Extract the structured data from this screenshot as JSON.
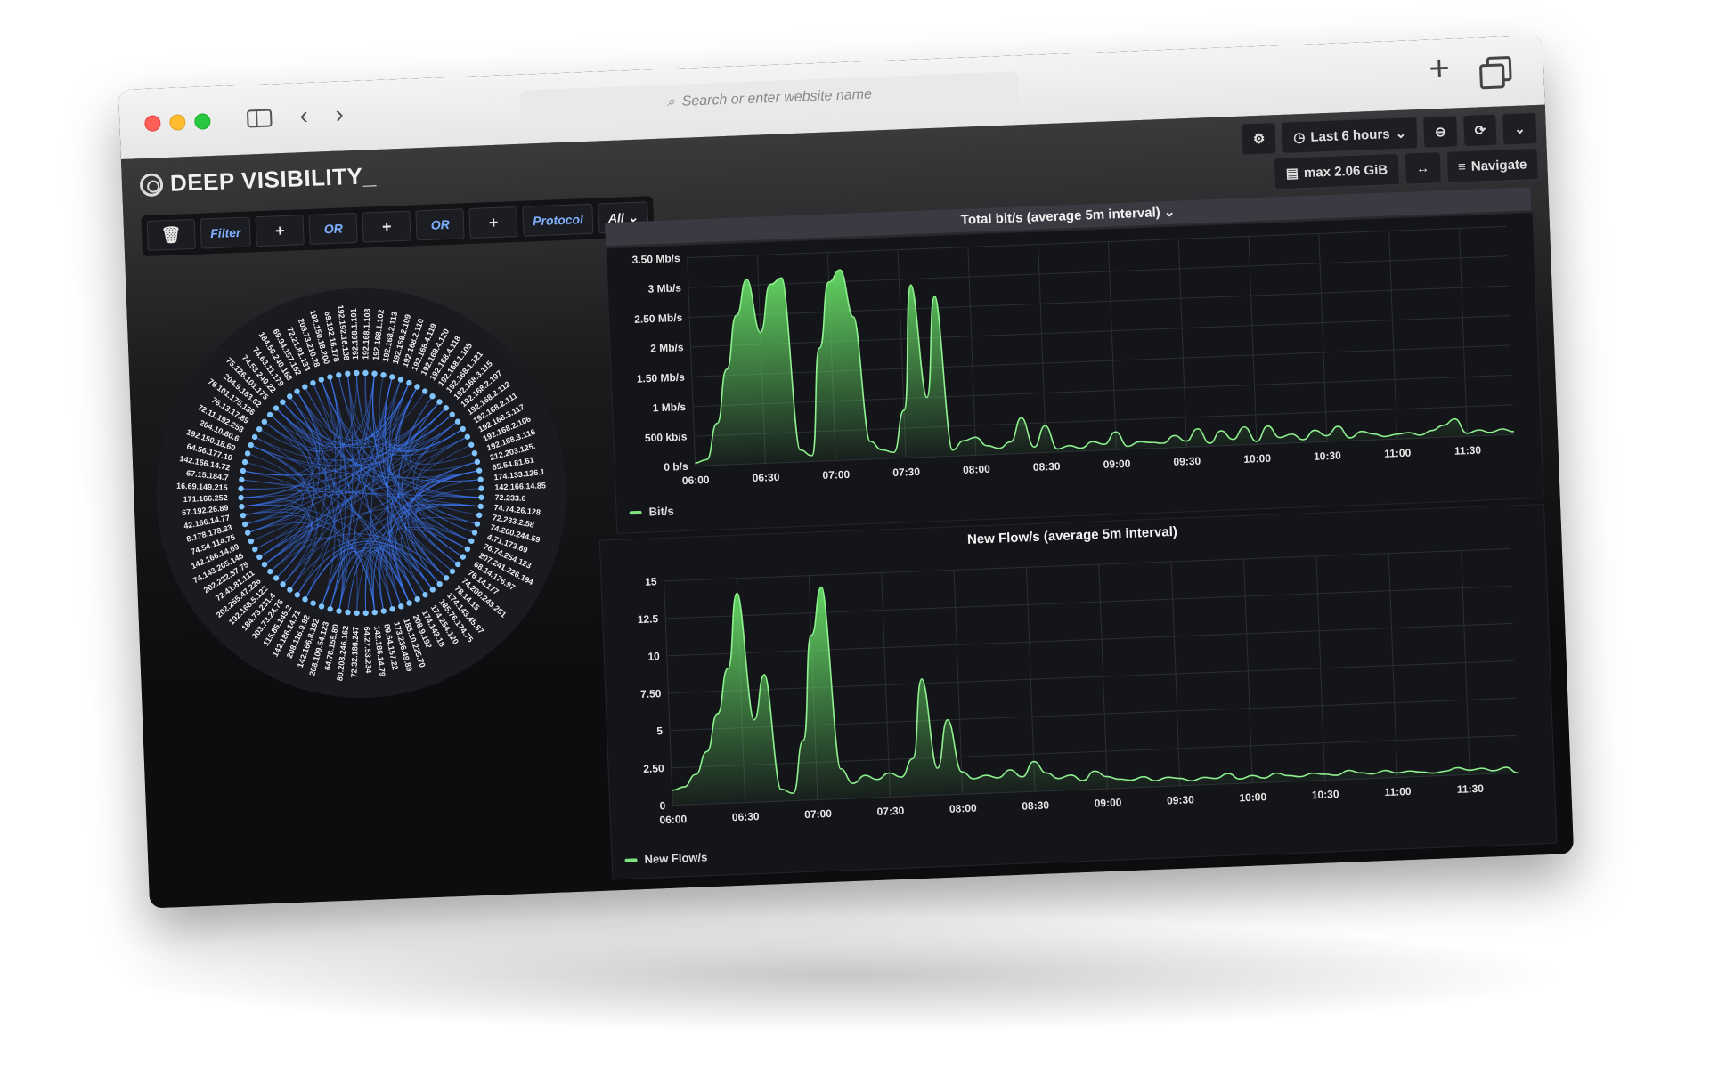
{
  "browser": {
    "search_placeholder": "Search or enter website name"
  },
  "app": {
    "brand": "DEEP VISIBILITY_",
    "time_range": "Last 6 hours",
    "max_label": "max 2.06 GiB",
    "navigate_label": "Navigate"
  },
  "filters": {
    "filter_label": "Filter",
    "or1_label": "OR",
    "or2_label": "OR",
    "protocol_label": "Protocol",
    "protocol_value": "All",
    "plus": "+"
  },
  "chord": {
    "nodes": [
      "192.168.1.101",
      "192.168.1.103",
      "192.168.1.102",
      "192.168.2.113",
      "192.168.2.109",
      "192.168.2.110",
      "192.168.4.119",
      "192.168.4.120",
      "192.168.4.118",
      "192.168.1.105",
      "192.168.1.121",
      "192.168.3.115",
      "192.168.2.107",
      "192.168.2.112",
      "192.168.2.111",
      "192.168.3.117",
      "192.168.2.106",
      "192.168.3.116",
      "212.203.125.",
      "65.54.81.61",
      "174.133.126.1",
      "142.166.14.85",
      "72.233.6",
      "74.74.26.128",
      "72.233.2.58",
      "74.200.244.59",
      "4.71.173.69",
      "76.74.254.123",
      "207.241.226.194",
      "68.14.176.97",
      "76.14.177",
      "74.200.243.251",
      "78.14.15",
      "174.143.45.87",
      "185.76.174.75",
      "174.254.120",
      "174.143.18",
      "208.9.192",
      "185.10.225.70",
      "173.236.49.89",
      "89.64.157.22",
      "142.186.14.79",
      "64.27.53.234",
      "72.32.186.247",
      "80.208.246.162",
      "64.78.155.80",
      "208.109.54.123",
      "142.166.8.192",
      "208.116.9.82",
      "142.186.14.71",
      "115.85.145.2",
      "203.73.24.76",
      "184.73.231.4",
      "192.168.5.122",
      "202.255.47.226",
      "72.41.81.111",
      "202.232.87.75",
      "74.143.205.146",
      "142.166.14.69",
      "74.54.114.75",
      "8.178.178.33",
      "42.166.14.77",
      "67.192.26.89",
      "171.166.252",
      "16.69.149.215",
      "67.15.184.7",
      "142.166.14.72",
      "64.56.177.10",
      "192.150.18.60",
      "204.10.60.6",
      "72.11.192.253",
      "76.13.17.89",
      "76.101.175.136",
      "204.9.163.62",
      "75.126.101.175",
      "74.53.240.22",
      "74.63.11.179",
      "184.50.240.168",
      "69.94.157.162",
      "72.21.81.133",
      "208.73.210.28",
      "192.150.18.200",
      "69.192.16.178",
      "192.192.16.138"
    ]
  },
  "chart_data": [
    {
      "type": "area",
      "title": "Total bit/s (average 5m interval)",
      "ylabel": "",
      "x": [
        "06:00",
        "06:05",
        "06:10",
        "06:15",
        "06:20",
        "06:25",
        "06:30",
        "06:35",
        "06:40",
        "06:45",
        "06:50",
        "06:55",
        "07:00",
        "07:05",
        "07:10",
        "07:15",
        "07:20",
        "07:25",
        "07:30",
        "07:35",
        "07:40",
        "07:45",
        "07:50",
        "07:55",
        "08:00",
        "08:05",
        "08:10",
        "08:15",
        "08:20",
        "08:25",
        "08:30",
        "08:35",
        "08:40",
        "08:45",
        "08:50",
        "08:55",
        "09:00",
        "09:05",
        "09:10",
        "09:15",
        "09:20",
        "09:25",
        "09:30",
        "09:35",
        "09:40",
        "09:45",
        "09:50",
        "09:55",
        "10:00",
        "10:05",
        "10:10",
        "10:15",
        "10:20",
        "10:25",
        "10:30",
        "10:35",
        "10:40",
        "10:45",
        "10:50",
        "10:55",
        "11:00",
        "11:05",
        "11:10",
        "11:15",
        "11:20",
        "11:25",
        "11:30",
        "11:35",
        "11:40",
        "11:45",
        "11:50"
      ],
      "series": [
        {
          "name": "Bit/s",
          "values": [
            0.05,
            0.1,
            0.7,
            1.6,
            2.5,
            3.1,
            2.2,
            3.0,
            3.1,
            0.2,
            0.1,
            1.9,
            3.0,
            3.2,
            2.4,
            0.3,
            0.15,
            0.1,
            0.8,
            2.9,
            1.0,
            2.7,
            0.1,
            0.25,
            0.3,
            0.15,
            0.1,
            0.2,
            0.6,
            0.1,
            0.45,
            0.05,
            0.1,
            0.05,
            0.15,
            0.1,
            0.3,
            0.05,
            0.12,
            0.1,
            0.08,
            0.2,
            0.1,
            0.3,
            0.05,
            0.25,
            0.1,
            0.3,
            0.05,
            0.3,
            0.1,
            0.15,
            0.05,
            0.2,
            0.1,
            0.25,
            0.05,
            0.15,
            0.1,
            0.05,
            0.08,
            0.1,
            0.05,
            0.12,
            0.2,
            0.3,
            0.05,
            0.1,
            0.05,
            0.1,
            0.05
          ]
        }
      ],
      "y_ticks": [
        "0 b/s",
        "500 kb/s",
        "1 Mb/s",
        "1.50 Mb/s",
        "2 Mb/s",
        "2.50 Mb/s",
        "3 Mb/s",
        "3.50 Mb/s"
      ],
      "x_ticks": [
        "06:00",
        "06:30",
        "07:00",
        "07:30",
        "08:00",
        "08:30",
        "09:00",
        "09:30",
        "10:00",
        "10:30",
        "11:00",
        "11:30"
      ],
      "ylim": [
        0,
        3.5
      ],
      "y_unit": "Mb/s",
      "legend_position": "bottom-left",
      "grid": true,
      "color": "#66dd66"
    },
    {
      "type": "area",
      "title": "New Flow/s (average 5m interval)",
      "ylabel": "",
      "x": [
        "06:00",
        "06:05",
        "06:10",
        "06:15",
        "06:20",
        "06:25",
        "06:30",
        "06:35",
        "06:40",
        "06:45",
        "06:50",
        "06:55",
        "07:00",
        "07:05",
        "07:10",
        "07:15",
        "07:20",
        "07:25",
        "07:30",
        "07:35",
        "07:40",
        "07:45",
        "07:50",
        "07:55",
        "08:00",
        "08:05",
        "08:10",
        "08:15",
        "08:20",
        "08:25",
        "08:30",
        "08:35",
        "08:40",
        "08:45",
        "08:50",
        "08:55",
        "09:00",
        "09:05",
        "09:10",
        "09:15",
        "09:20",
        "09:25",
        "09:30",
        "09:35",
        "09:40",
        "09:45",
        "09:50",
        "09:55",
        "10:00",
        "10:05",
        "10:10",
        "10:15",
        "10:20",
        "10:25",
        "10:30",
        "10:35",
        "10:40",
        "10:45",
        "10:50",
        "10:55",
        "11:00",
        "11:05",
        "11:10",
        "11:15",
        "11:20",
        "11:25",
        "11:30",
        "11:35",
        "11:40",
        "11:45",
        "11:50"
      ],
      "series": [
        {
          "name": "New Flow/s",
          "values": [
            1.0,
            1.2,
            2.0,
            3.5,
            6.0,
            9.0,
            14.0,
            5.5,
            8.5,
            0.8,
            0.5,
            4.0,
            11.0,
            14.2,
            2.0,
            1.0,
            1.5,
            1.2,
            1.6,
            1.3,
            2.5,
            7.8,
            1.8,
            5.0,
            1.5,
            1.0,
            1.2,
            1.0,
            1.5,
            1.0,
            2.0,
            1.2,
            0.8,
            1.0,
            0.6,
            1.2,
            0.8,
            0.6,
            0.5,
            0.7,
            0.4,
            0.6,
            0.5,
            0.3,
            0.5,
            0.4,
            0.7,
            0.3,
            0.5,
            0.3,
            0.6,
            0.4,
            0.3,
            0.5,
            0.4,
            0.3,
            0.6,
            0.4,
            0.3,
            0.5,
            0.3,
            0.4,
            0.3,
            0.2,
            0.3,
            0.5,
            0.3,
            0.4,
            0.2,
            0.4,
            0.0
          ]
        }
      ],
      "y_ticks": [
        "0",
        "2.50",
        "5",
        "7.50",
        "10",
        "12.5",
        "15"
      ],
      "x_ticks": [
        "06:00",
        "06:30",
        "07:00",
        "07:30",
        "08:00",
        "08:30",
        "09:00",
        "09:30",
        "10:00",
        "10:30",
        "11:00",
        "11:30"
      ],
      "ylim": [
        0,
        15
      ],
      "legend_position": "bottom-left",
      "grid": true,
      "color": "#66dd66"
    }
  ]
}
